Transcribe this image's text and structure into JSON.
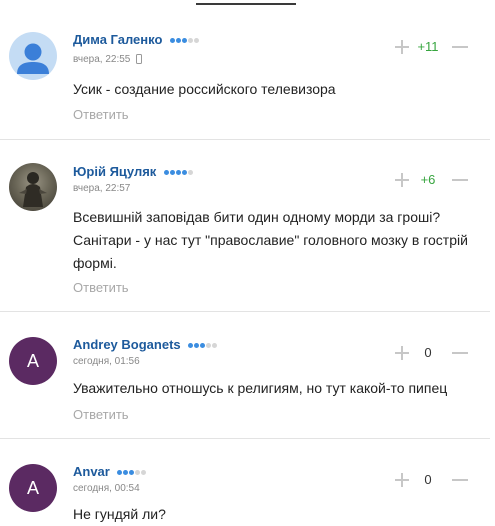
{
  "comments": [
    {
      "author": "Дима Галенко",
      "rank_dots": [
        true,
        true,
        true,
        false,
        false
      ],
      "time": "вчера, 22:55",
      "device": "phone-icon",
      "text": "Усик - создание российского телевизора",
      "reply_label": "Ответить",
      "score": "+11",
      "avatar": {
        "type": "default",
        "icon": "user-silhouette-icon"
      }
    },
    {
      "author": "Юрій Яцуляк",
      "rank_dots": [
        true,
        true,
        true,
        true,
        false
      ],
      "time": "вчера, 22:57",
      "text": "Всевишній заповідав бити один одному морди за гроші? Санітари - у нас тут \"православие\" головного мозку в гострій формі.",
      "reply_label": "Ответить",
      "score": "+6",
      "avatar": {
        "type": "photo",
        "icon": "warrior-photo-icon"
      }
    },
    {
      "author": "Andrey Boganets",
      "rank_dots": [
        true,
        true,
        true,
        false,
        false
      ],
      "time": "сегодня, 01:56",
      "text": "Уважительно отношусь к религиям, но тут какой-то пипец",
      "reply_label": "Ответить",
      "score": "0",
      "avatar": {
        "type": "letter",
        "letter": "A"
      }
    },
    {
      "author": "Anvar",
      "rank_dots": [
        true,
        true,
        true,
        false,
        false
      ],
      "time": "сегодня, 00:54",
      "text": "Не гундяй ли?",
      "score": "0",
      "avatar": {
        "type": "letter",
        "letter": "A"
      }
    }
  ],
  "colors": {
    "author": "#1d5a9c",
    "positive": "#37a53f",
    "dot_on": "#3b8de0",
    "dot_off": "#d6d6d6",
    "letter_avatar": "#5b2a62"
  }
}
